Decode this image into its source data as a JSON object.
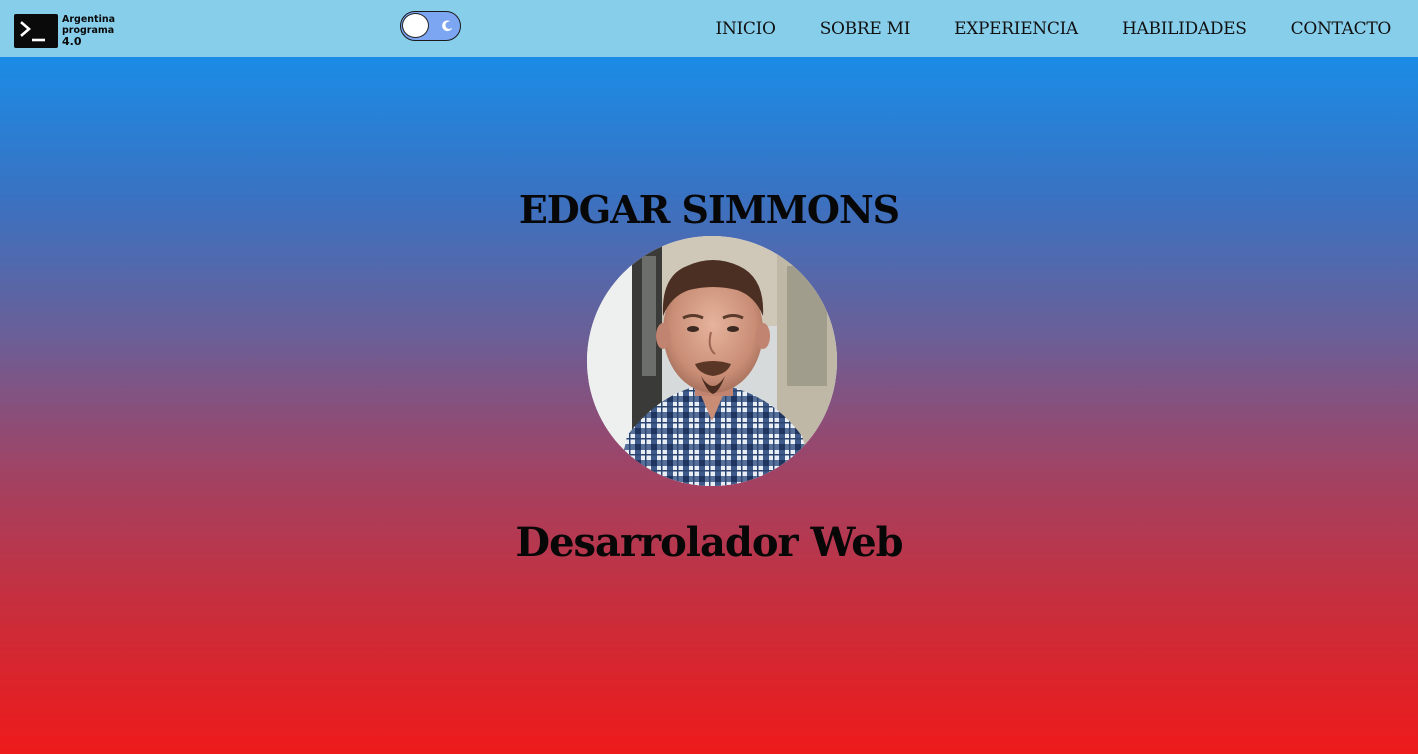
{
  "brand": {
    "logo_lines": [
      "Argentina",
      "programa",
      "4.0"
    ],
    "icon": "terminal-prompt-icon"
  },
  "theme_toggle": {
    "state": "light",
    "icon": "moon-icon"
  },
  "nav": {
    "items": [
      {
        "label": "INICIO"
      },
      {
        "label": "SOBRE MI"
      },
      {
        "label": "EXPERIENCIA"
      },
      {
        "label": "HABILIDADES"
      },
      {
        "label": "CONTACTO"
      }
    ]
  },
  "hero": {
    "name": "EDGAR SIMMONS",
    "role": "Desarrolador Web",
    "photo": "profile-photo"
  },
  "colors": {
    "navbar": "#87ceeb",
    "gradient_top": "#1a8ce6",
    "gradient_bottom": "#ee1a1a",
    "toggle": "#7da6f2",
    "text": "#070707"
  }
}
